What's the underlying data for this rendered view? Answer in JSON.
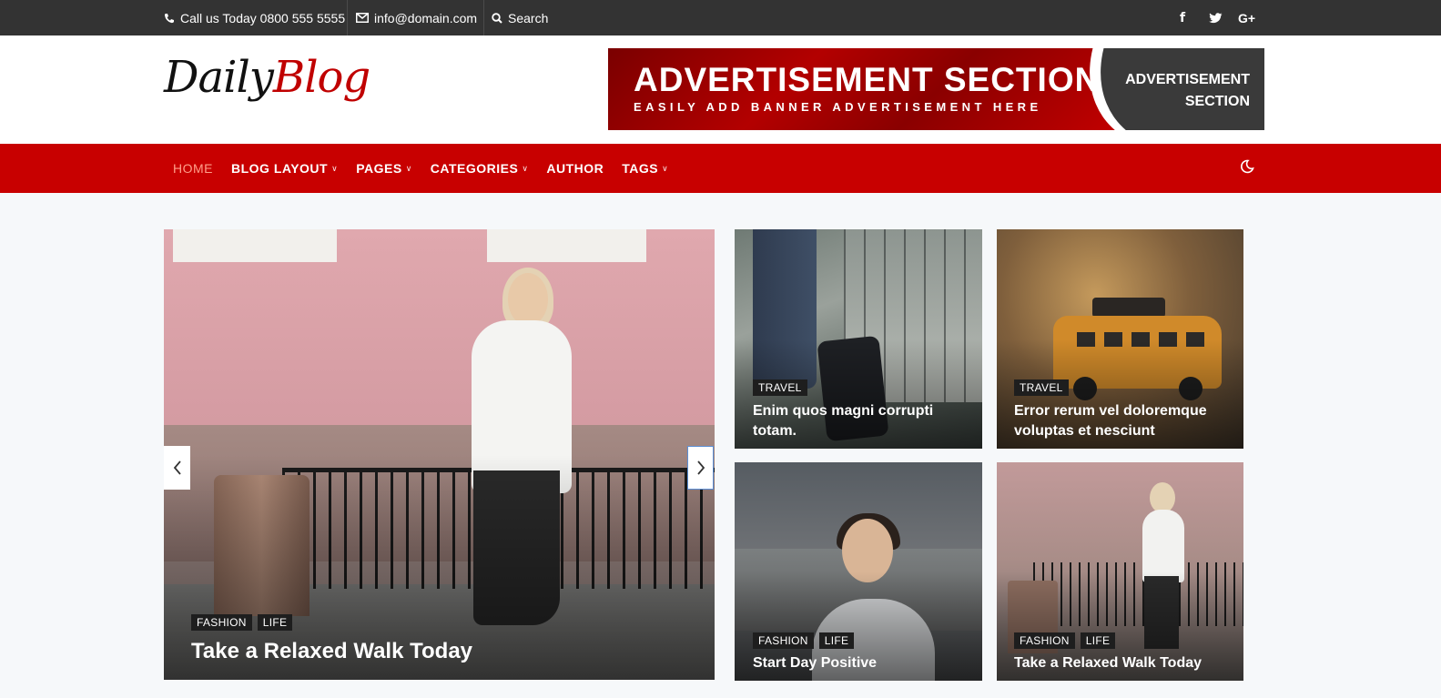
{
  "topbar": {
    "phone": "Call us Today 0800 555 5555",
    "email": "info@domain.com",
    "search": "Search",
    "social": [
      {
        "icon": "facebook-icon",
        "glyph": "f"
      },
      {
        "icon": "twitter-icon",
        "glyph": "t"
      },
      {
        "icon": "google-plus-icon",
        "glyph": "G+"
      }
    ]
  },
  "header": {
    "logo_part1": "Daily",
    "logo_part2": "Blog",
    "ad": {
      "title": "ADVERTISEMENT SECTION",
      "subtitle": "EASILY ADD BANNER ADVERTISEMENT HERE",
      "right_line1": "ADVERTISEMENT",
      "right_line2": "SECTION"
    }
  },
  "nav": {
    "items": [
      {
        "label": "HOME",
        "dropdown": false,
        "active": true
      },
      {
        "label": "BLOG LAYOUT",
        "dropdown": true
      },
      {
        "label": "PAGES",
        "dropdown": true
      },
      {
        "label": "CATEGORIES",
        "dropdown": true
      },
      {
        "label": "AUTHOR",
        "dropdown": false
      },
      {
        "label": "TAGS",
        "dropdown": true
      }
    ]
  },
  "featured": {
    "main": {
      "tags": [
        "FASHION",
        "LIFE"
      ],
      "title": "Take a Relaxed Walk Today"
    },
    "cards": [
      {
        "tags": [
          "TRAVEL"
        ],
        "title": "Enim quos magni corrupti totam."
      },
      {
        "tags": [
          "TRAVEL"
        ],
        "title": "Error rerum vel doloremque voluptas et nesciunt"
      },
      {
        "tags": [
          "FASHION",
          "LIFE"
        ],
        "title": "Start Day Positive"
      },
      {
        "tags": [
          "FASHION",
          "LIFE"
        ],
        "title": "Take a Relaxed Walk Today"
      }
    ]
  },
  "colors": {
    "topbar": "#333333",
    "nav": "#c80000",
    "accent_red": "#c00000",
    "active_nav": "#ff9f8a"
  }
}
